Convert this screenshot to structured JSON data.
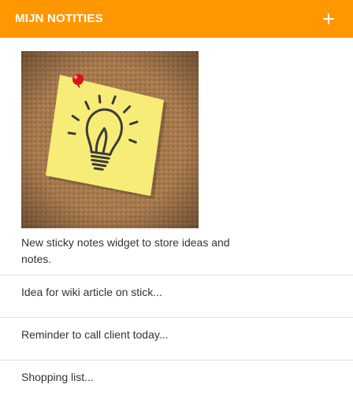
{
  "header": {
    "title": "MIJN NOTITIES",
    "add_icon": "plus-icon"
  },
  "notes": [
    {
      "text": "New sticky notes widget to store ideas and notes.",
      "image": "lightbulb-sticky-note-on-corkboard"
    },
    {
      "text": "Idea for wiki article on stick..."
    },
    {
      "text": "Reminder to call client today..."
    },
    {
      "text": "Shopping list..."
    }
  ],
  "colors": {
    "header_bg": "#ff9700",
    "header_text": "#ffffff",
    "text": "#333333",
    "divider": "#e0e0e0",
    "sticky_note": "#f5e96b",
    "cork": "#a97b4f"
  }
}
